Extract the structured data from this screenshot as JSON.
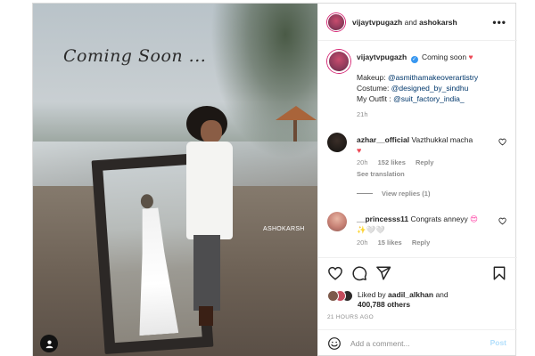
{
  "photo": {
    "overlay_text": "Coming Soon ...",
    "watermark": "ASHOKARSH"
  },
  "header": {
    "user1": "vijaytvpugazh",
    "joiner": "and",
    "user2": "ashokarsh",
    "more_icon": "more-horizontal-icon"
  },
  "caption": {
    "username": "vijaytvpugazh",
    "text": "Coming soon",
    "lines": [
      {
        "label": "Makeup: ",
        "handle": "@asmithamakeoverartistry"
      },
      {
        "label": "Costume: ",
        "handle": "@designed_by_sindhu"
      },
      {
        "label": "My Outfit : ",
        "handle": "@suit_factory_india_"
      }
    ],
    "time": "21h"
  },
  "comments": [
    {
      "username": "azhar__official",
      "text": "Vazthukkal macha",
      "time": "20h",
      "likes": "152 likes",
      "reply": "Reply",
      "see_translation": "See translation",
      "view_replies": "View replies (1)"
    },
    {
      "username": "__princesss11",
      "text": "Congrats anneyy",
      "emoji_line": "✨🤍🤍",
      "time": "20h",
      "likes": "15 likes",
      "reply": "Reply"
    }
  ],
  "likes": {
    "prefix": "Liked by",
    "user": "aadil_alkhan",
    "joiner": "and",
    "others": "400,788 others"
  },
  "time_ago": "21 HOURS AGO",
  "comment_box": {
    "placeholder": "Add a comment...",
    "post_label": "Post"
  },
  "colors": {
    "accent_blue": "#3897f0",
    "heart_red": "#ed4956",
    "post_disabled": "#b2dffc",
    "mention_blue": "#00376b"
  }
}
